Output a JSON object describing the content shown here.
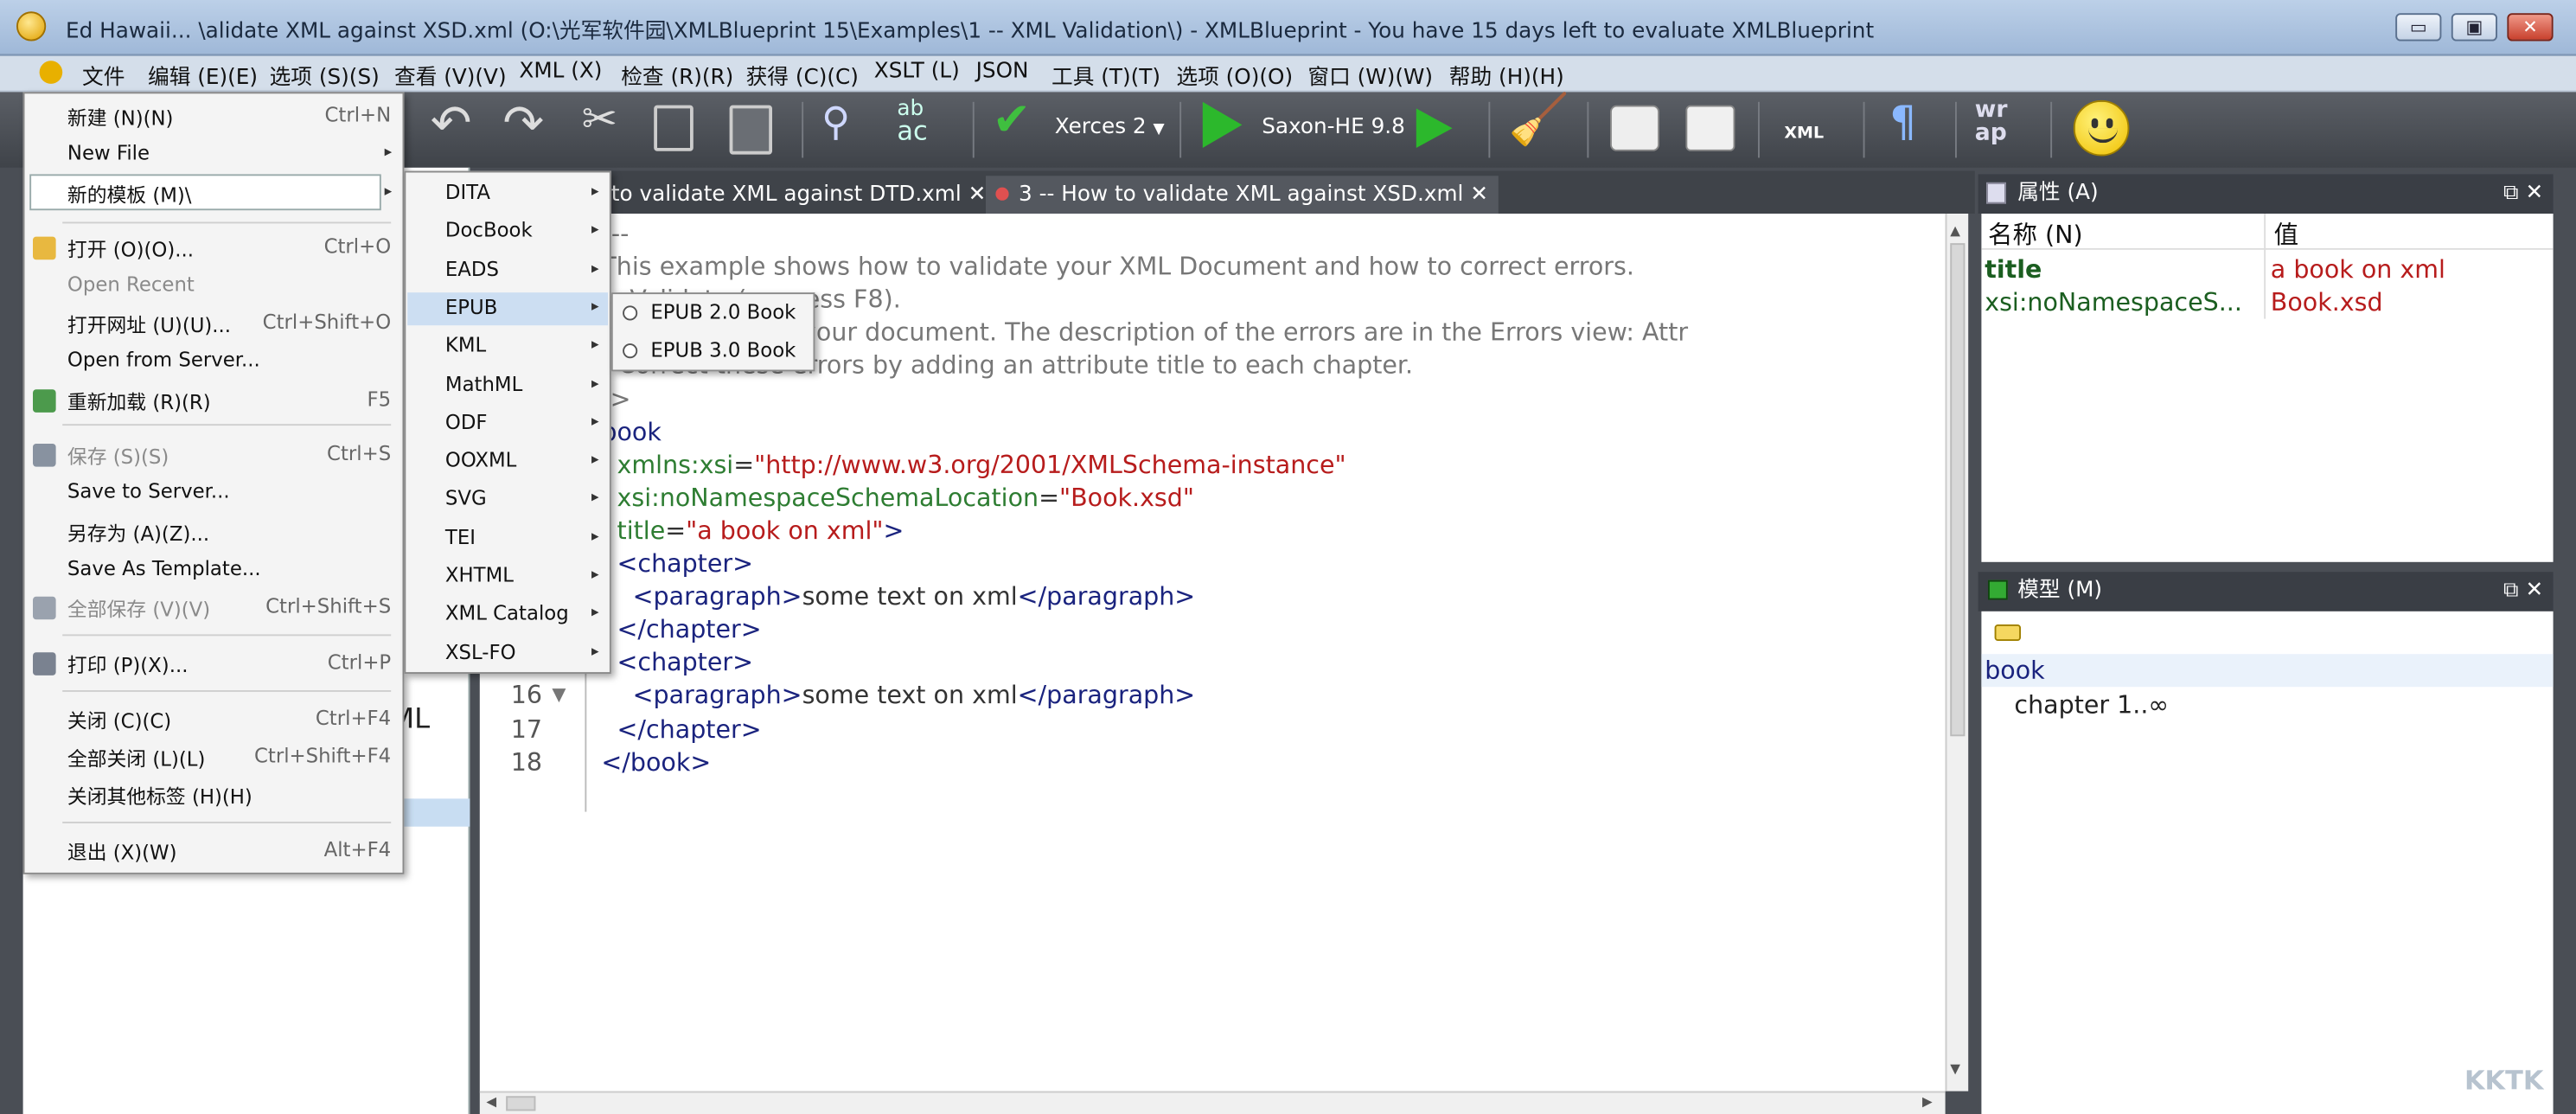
{
  "window": {
    "title": "Ed Hawaii... \\alidate XML against XSD.xml  (O:\\光军软件园\\XMLBlueprint 15\\Examples\\1 -- XML Validation\\) - XMLBlueprint - You have 15 days left to evaluate XMLBlueprint",
    "minimize": "▭",
    "maximize": "▣",
    "close": "✕"
  },
  "menubar": [
    "文件",
    "编辑 (E)(E)",
    "选项 (S)(S)",
    "查看 (V)(V)",
    "XML (X)",
    "检查 (R)(R)",
    "获得 (C)(C)",
    "XSLT (L)",
    "JSON",
    "工具 (T)(T)",
    "选项 (O)(O)",
    "窗口 (W)(W)",
    "帮助 (H)(H)"
  ],
  "toolbar": {
    "validator": "Xerces 2",
    "transformer": "Saxon-HE 9.8",
    "xml_label": "XML",
    "pilcrow": "¶",
    "wrap_top": "wr",
    "wrap_bot": "ap",
    "abc_top": "ab",
    "abc_bot": "ac"
  },
  "tabs": [
    {
      "label": "to validate XML against DTD.xml",
      "close": "✕"
    },
    {
      "label": "3 -- How to validate XML against XSD.xml",
      "close": "✕"
    }
  ],
  "left_panel": {
    "partial_text": "e XML"
  },
  "file_menu": [
    {
      "label": "新建 (N)(N)",
      "shortcut": "Ctrl+N"
    },
    {
      "label": "New File",
      "arrow": "▸"
    },
    {
      "label": "新的模板 (M)\\",
      "arrow": "▸"
    },
    {
      "label": "打开 (O)(O)...",
      "shortcut": "Ctrl+O"
    },
    {
      "label": "Open Recent"
    },
    {
      "label": "打开网址 (U)(U)...",
      "shortcut": "Ctrl+Shift+O"
    },
    {
      "label": "Open from Server..."
    },
    {
      "label": "重新加载 (R)(R)",
      "shortcut": "F5"
    },
    {
      "label": "保存 (S)(S)",
      "shortcut": "Ctrl+S"
    },
    {
      "label": "Save to Server..."
    },
    {
      "label": "另存为 (A)(Z)..."
    },
    {
      "label": "Save As Template..."
    },
    {
      "label": "全部保存 (V)(V)",
      "shortcut": "Ctrl+Shift+S"
    },
    {
      "label": "打印 (P)(X)...",
      "shortcut": "Ctrl+P"
    },
    {
      "label": "关闭 (C)(C)",
      "shortcut": "Ctrl+F4"
    },
    {
      "label": "全部关闭 (L)(L)",
      "shortcut": "Ctrl+Shift+F4"
    },
    {
      "label": "关闭其他标签 (H)(H)"
    },
    {
      "label": "退出 (X)(W)",
      "shortcut": "Alt+F4"
    }
  ],
  "template_menu": [
    "DITA",
    "DocBook",
    "EADS",
    "EPUB",
    "KML",
    "MathML",
    "ODF",
    "OOXML",
    "SVG",
    "TEI",
    "XHTML",
    "XML Catalog",
    "XSL-FO"
  ],
  "epub_menu": [
    "EPUB 2.0 Book",
    "EPUB 3.0 Book"
  ],
  "editor": {
    "lines": [
      {
        "n": "",
        "parts": [
          {
            "c": "c",
            "t": "!--"
          }
        ]
      },
      {
        "n": "",
        "parts": [
          {
            "c": "c",
            "t": "This example shows how to validate your XML Document and how to correct errors."
          }
        ]
      },
      {
        "n": "",
        "parts": [
          {
            "c": "c",
            "t": "> Validate (or press F8)."
          }
        ]
      },
      {
        "n": "",
        "parts": [
          {
            "c": "c",
            "t": "e highlighted in your document. The description of the errors are in the Errors view: Attr"
          }
        ]
      },
      {
        "n": "",
        "parts": [
          {
            "c": "c",
            "t": "- Correct these errors by adding an attribute title to each chapter."
          }
        ]
      },
      {
        "n": "",
        "parts": [
          {
            "c": "c",
            "t": "->"
          }
        ]
      },
      {
        "n": "",
        "parts": [
          {
            "c": "t",
            "t": "book"
          }
        ]
      },
      {
        "n": "",
        "parts": [
          {
            "c": "a",
            "t": "  xmlns:xsi"
          },
          {
            "c": "",
            "t": "="
          },
          {
            "c": "v",
            "t": "\"http://www.w3.org/2001/XMLSchema-instance\""
          }
        ]
      },
      {
        "n": "",
        "parts": [
          {
            "c": "a",
            "t": "  xsi:noNamespaceSchemaLocation"
          },
          {
            "c": "",
            "t": "="
          },
          {
            "c": "v",
            "t": "\"Book.xsd\""
          }
        ]
      },
      {
        "n": "",
        "parts": [
          {
            "c": "a",
            "t": "  title"
          },
          {
            "c": "",
            "t": "="
          },
          {
            "c": "v",
            "t": "\"a book on xml\""
          },
          {
            "c": "t",
            "t": ">"
          }
        ]
      },
      {
        "n": "",
        "parts": [
          {
            "c": "t",
            "t": "  <chapter>"
          }
        ]
      },
      {
        "n": "",
        "parts": [
          {
            "c": "t",
            "t": "    <paragraph>"
          },
          {
            "c": "",
            "t": "some text on xml"
          },
          {
            "c": "t",
            "t": "</paragraph>"
          }
        ]
      },
      {
        "n": "",
        "parts": [
          {
            "c": "t",
            "t": "  </chapter>"
          }
        ]
      },
      {
        "n": "15",
        "parts": [
          {
            "c": "t",
            "t": "  <chapter>"
          }
        ]
      },
      {
        "n": "16",
        "parts": [
          {
            "c": "t",
            "t": "    <paragraph>"
          },
          {
            "c": "",
            "t": "some text on xml"
          },
          {
            "c": "t",
            "t": "</paragraph>"
          }
        ]
      },
      {
        "n": "17",
        "parts": [
          {
            "c": "t",
            "t": "  </chapter>"
          }
        ]
      },
      {
        "n": "18",
        "parts": [
          {
            "c": "t",
            "t": "</book>"
          }
        ]
      }
    ],
    "fold_marker": "▼"
  },
  "properties_panel": {
    "title": "属性 (A)",
    "col_name": "名称 (N)",
    "col_value": "值",
    "rows": [
      {
        "name": "title",
        "value": "a book on xml"
      },
      {
        "name": "xsi:noNamespaceS...",
        "value": "Book.xsd"
      }
    ]
  },
  "model_panel": {
    "title": "模型 (M)",
    "root": "book",
    "child": "chapter 1..∞"
  },
  "watermark": "KKTK"
}
